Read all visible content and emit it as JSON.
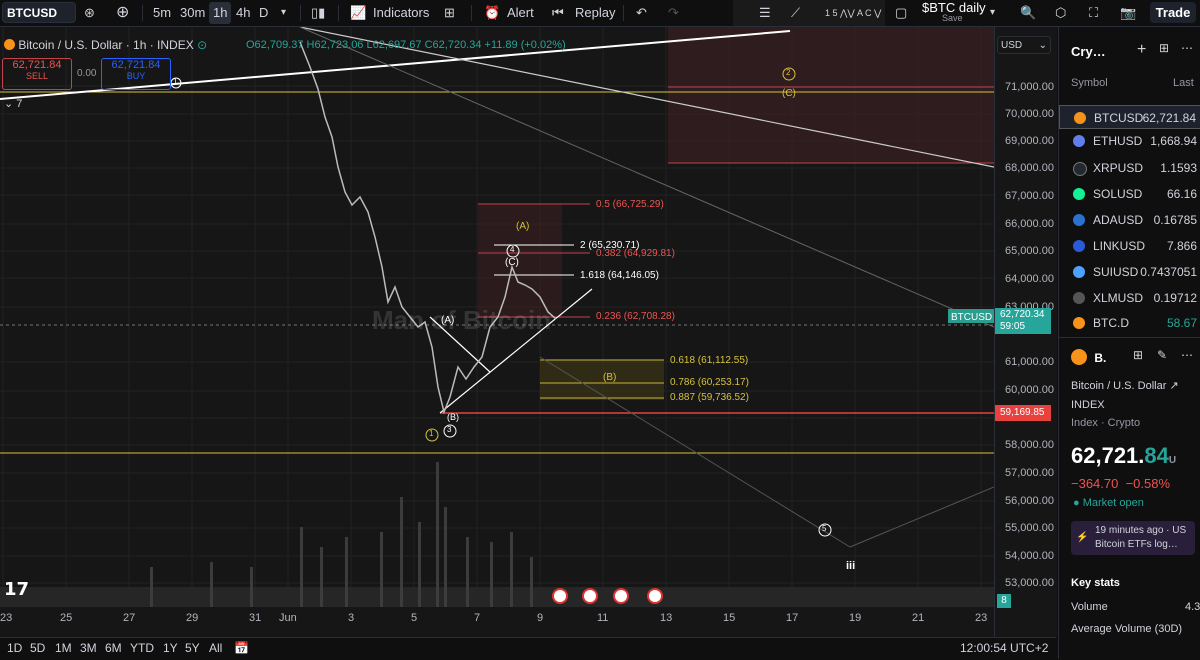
{
  "toolbar": {
    "symbol": "BTCUSD",
    "intervals": [
      "5m",
      "30m",
      "1h",
      "4h",
      "D"
    ],
    "active_interval": "1h",
    "indicators_label": "Indicators",
    "alert_label": "Alert",
    "replay_label": "Replay",
    "layout_name": "$BTC daily",
    "layout_save": "Save",
    "trade_label": "Trade"
  },
  "legend": {
    "title": "Bitcoin / U.S. Dollar · 1h · INDEX",
    "ohlc": "O62,709.37 H62,723.06 L62,697.67 C62,720.34 +11.89 (+0.02%)",
    "sell_price": "62,721.84",
    "sell_label": "SELL",
    "spread": "0.00",
    "buy_price": "62,721.84",
    "buy_label": "BUY",
    "indicator_count": "7"
  },
  "watermark": "Man of Bitcoin",
  "price_axis": {
    "currency": "USD",
    "ticks": [
      "71,000.00",
      "70,000.00",
      "69,000.00",
      "68,000.00",
      "67,000.00",
      "66,000.00",
      "65,000.00",
      "64,000.00",
      "63,000.00",
      "61,000.00",
      "60,000.00",
      "59,000.00",
      "58,000.00",
      "57,000.00",
      "56,000.00",
      "55,000.00",
      "54,000.00",
      "53,000.00"
    ],
    "current_price": "62,720.34",
    "countdown": "59:05",
    "marked_price": "59,169.85",
    "symbol_tag": "BTCUSD",
    "footer_badge": "8"
  },
  "time_axis": {
    "ticks": [
      "23",
      "25",
      "27",
      "29",
      "31",
      "Jun",
      "3",
      "5",
      "7",
      "9",
      "11",
      "13",
      "15",
      "17",
      "19",
      "21",
      "23"
    ]
  },
  "annotations": {
    "fib_a": [
      "0.5 (66,725.29)",
      "0.382 (64,929.81)",
      "0.236 (62,708.28)"
    ],
    "fib_ext": [
      "2 (65,230.71)",
      "1.618 (64,146.05)"
    ],
    "fib_b": [
      "0.618 (61,112.55)",
      "0.786 (60,253.17)",
      "0.887 (59,736.52)"
    ],
    "waves": {
      "A_upper": "(A)",
      "C_upper": "(C)",
      "w4": "4",
      "A_lower": "(A)",
      "B": "(B)",
      "B_lower": "(B)",
      "w1": "1",
      "w3": "3",
      "w2": "2",
      "C_top": "(C)",
      "w5": "5",
      "iii": "iii",
      "w1_left": "1"
    }
  },
  "bottombar": {
    "ranges": [
      "1D",
      "5D",
      "1M",
      "3M",
      "6M",
      "YTD",
      "1Y",
      "5Y",
      "All"
    ],
    "clock": "12:00:54 UTC+2"
  },
  "watchlist": {
    "title": "Cry…",
    "col_symbol": "Symbol",
    "col_last": "Last",
    "rows": [
      {
        "symbol": "BTCUSD",
        "last": "62,721.84",
        "color": "#f7931a"
      },
      {
        "symbol": "ETHUSD",
        "last": "1,668.94",
        "color": "#627eea"
      },
      {
        "symbol": "XRPUSD",
        "last": "1.1593",
        "color": "#23292f"
      },
      {
        "symbol": "SOLUSD",
        "last": "66.16",
        "color": "#14f195"
      },
      {
        "symbol": "ADAUSD",
        "last": "0.16785",
        "color": "#2a71d0"
      },
      {
        "symbol": "LINKUSD",
        "last": "7.866",
        "color": "#2a5ada"
      },
      {
        "symbol": "SUIUSD",
        "last": "0.7437051",
        "color": "#4da2ff"
      },
      {
        "symbol": "XLMUSD",
        "last": "0.19712",
        "color": "#555"
      },
      {
        "symbol": "BTC.D",
        "last": "58.67",
        "color": "#f7931a"
      }
    ]
  },
  "details": {
    "short_symbol": "B.",
    "name": "Bitcoin / U.S. Dollar",
    "exchange": "INDEX",
    "category": "Index · Crypto",
    "price_main": "62,721.",
    "price_tail": "84",
    "price_unit": "U",
    "change": "−364.70",
    "change_pct": "−0.58%",
    "market_status": "Market open",
    "news_time": "19 minutes ago · US",
    "news_headline": "Bitcoin ETFs log…",
    "key_stats": "Key stats",
    "volume_label": "Volume",
    "volume_value": "4.3",
    "avg_volume_label": "Average Volume (30D)"
  }
}
